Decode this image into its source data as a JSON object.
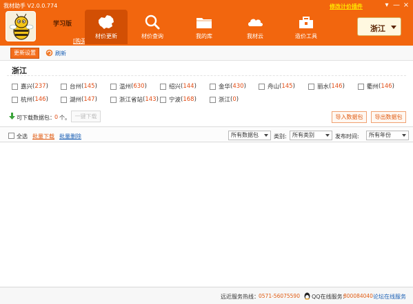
{
  "window": {
    "title": "我材助手 V2.0.0.774",
    "promo_link": "修改计价插件",
    "buttons": [
      "▾",
      "—",
      "×"
    ]
  },
  "header": {
    "edition": "学习版",
    "purchase": "[购买]",
    "nav_tabs": [
      {
        "label": "材价更新",
        "icon": "china-map-icon",
        "active": true
      },
      {
        "label": "材价查询",
        "icon": "search-icon",
        "active": false
      },
      {
        "label": "我的库",
        "icon": "folder-icon",
        "active": false
      },
      {
        "label": "我材云",
        "icon": "cloud-icon",
        "active": false
      },
      {
        "label": "造价工具",
        "icon": "toolbox-icon",
        "active": false
      }
    ],
    "province": "浙江"
  },
  "toolbar": {
    "update_settings": "更新设置",
    "refresh": "刷新"
  },
  "region": {
    "title": "浙江",
    "cities": [
      {
        "name": "嘉兴",
        "count": "237"
      },
      {
        "name": "台州",
        "count": "145"
      },
      {
        "name": "温州",
        "count": "630"
      },
      {
        "name": "绍兴",
        "count": "144"
      },
      {
        "name": "金华",
        "count": "430"
      },
      {
        "name": "舟山",
        "count": "145"
      },
      {
        "name": "丽水",
        "count": "146"
      },
      {
        "name": "衢州",
        "count": "146"
      },
      {
        "name": "杭州",
        "count": "146"
      },
      {
        "name": "湖州",
        "count": "147"
      },
      {
        "name": "浙江省站",
        "count": "143"
      },
      {
        "name": "宁波",
        "count": "168"
      },
      {
        "name": "浙江",
        "count": "0"
      }
    ]
  },
  "download": {
    "label": "可下载数据包：",
    "count": "0",
    "unit": "个。",
    "one_click": "一键下载",
    "import": "导入数据包",
    "export": "导出数据包"
  },
  "filters": {
    "select_all": "全选",
    "batch_download": "批量下载",
    "batch_delete": "批量删除",
    "package_value": "所有数据包",
    "category_label": "类别:",
    "category_value": "所有类别",
    "time_label": "发布时间:",
    "year_value": "所有年份"
  },
  "status": {
    "hotline_label": "远近服务热线：",
    "hotline": "0571-56075590",
    "qq_label": "QQ在线服务：",
    "qq": "800084040",
    "forum": "论坛在线服务"
  },
  "colors": {
    "brand_orange": "#f2660e",
    "active_tab": "#d24f04",
    "count_red": "#e14b13",
    "link_blue": "#1a5fb4"
  }
}
